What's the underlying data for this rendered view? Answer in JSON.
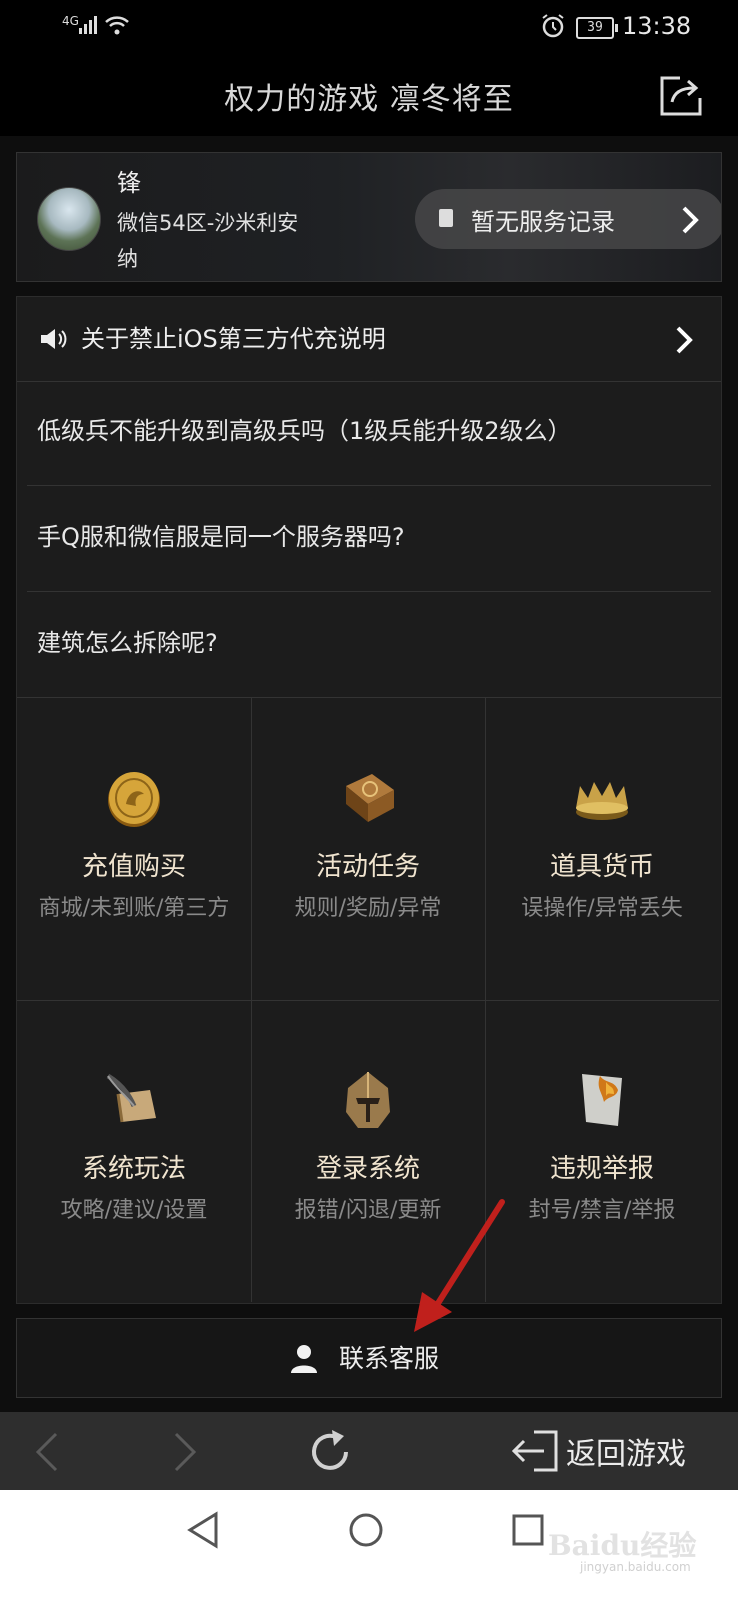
{
  "status_bar": {
    "network": "4G",
    "battery": "39",
    "time": "13:38"
  },
  "header": {
    "title": "权力的游戏 凛冬将至"
  },
  "user": {
    "name": "锋",
    "server_line1": "微信54区-沙米利安",
    "server_line2": "纳",
    "record_label": "暂无服务记录"
  },
  "notice": {
    "text": "关于禁止iOS第三方代充说明"
  },
  "faq": [
    {
      "text": "低级兵不能升级到高级兵吗（1级兵能升级2级么）"
    },
    {
      "text": "手Q服和微信服是同一个服务器吗?"
    },
    {
      "text": "建筑怎么拆除呢?"
    }
  ],
  "categories": [
    {
      "name": "充值购买",
      "sub": "商城/未到账/第三方",
      "icon": "gold-coin-icon"
    },
    {
      "name": "活动任务",
      "sub": "规则/奖励/异常",
      "icon": "book-icon"
    },
    {
      "name": "道具货币",
      "sub": "误操作/异常丢失",
      "icon": "crown-icon"
    },
    {
      "name": "系统玩法",
      "sub": "攻略/建议/设置",
      "icon": "scroll-quill-icon"
    },
    {
      "name": "登录系统",
      "sub": "报错/闪退/更新",
      "icon": "helmet-icon"
    },
    {
      "name": "违规举报",
      "sub": "封号/禁言/举报",
      "icon": "burning-paper-icon"
    }
  ],
  "contact": {
    "label": "联系客服"
  },
  "browser": {
    "exit_label": "返回游戏"
  },
  "watermark": {
    "text": "Baidu经验",
    "sub": "jingyan.baidu.com"
  },
  "colors": {
    "accent_text": "#f0e4cf",
    "annotation_arrow": "#c0201c"
  }
}
